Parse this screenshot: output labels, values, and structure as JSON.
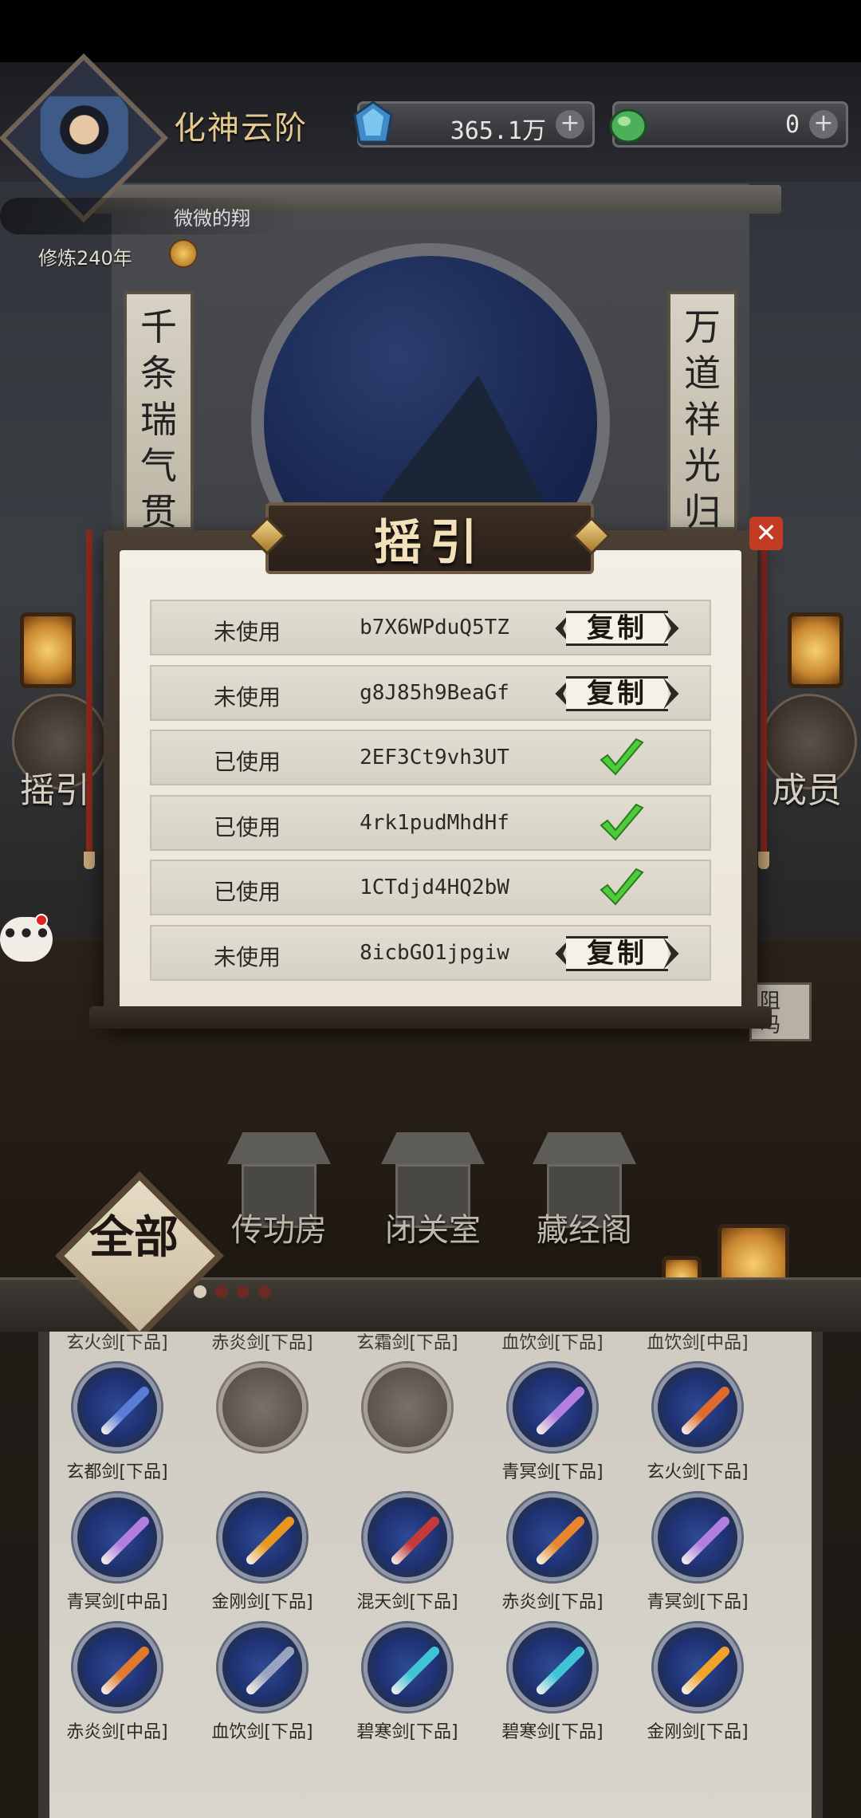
{
  "header": {
    "realm_title": "化神云阶",
    "jade_amount": "365.1万",
    "spirit_amount": "0",
    "plus_symbol": "+",
    "nickname": "微微的翔",
    "cultivation": "修炼240年"
  },
  "scene": {
    "couplet_left": "千条瑞气贯",
    "couplet_right": "万道祥光归",
    "side_left_label": "摇引",
    "side_right_label": "成员",
    "clipped_right_text": "阻\n吗"
  },
  "popup": {
    "title": "摇引",
    "close_symbol": "✕",
    "rows": [
      {
        "status": "未使用",
        "code": "b7X6WPduQ5TZ",
        "action": "复制"
      },
      {
        "status": "未使用",
        "code": "g8J85h9BeaGf",
        "action": "复制"
      },
      {
        "status": "已使用",
        "code": "2EF3Ct9vh3UT",
        "action": ""
      },
      {
        "status": "已使用",
        "code": "4rk1pudMhdHf",
        "action": ""
      },
      {
        "status": "已使用",
        "code": "1CTdjd4HQ2bW",
        "action": ""
      },
      {
        "status": "未使用",
        "code": "8icbGO1jpgiw",
        "action": "复制"
      }
    ]
  },
  "chat": {
    "symbol": "•••"
  },
  "buildings": [
    {
      "label": "传功房"
    },
    {
      "label": "闭关室"
    },
    {
      "label": "藏经阁"
    }
  ],
  "category_badge": "全部",
  "inventory": {
    "cut_labels": [
      "玄火剑[下品]",
      "赤炎剑[下品]",
      "玄霜剑[下品]",
      "血饮剑[下品]",
      "血饮剑[中品]"
    ],
    "rows": [
      [
        {
          "label": "玄都剑[下品]",
          "empty": false,
          "color": "#5a7bd8"
        },
        {
          "label": "",
          "empty": true,
          "color": ""
        },
        {
          "label": "",
          "empty": true,
          "color": ""
        },
        {
          "label": "青冥剑[下品]",
          "empty": false,
          "color": "#b27ee0"
        },
        {
          "label": "玄火剑[下品]",
          "empty": false,
          "color": "#e06a2c"
        }
      ],
      [
        {
          "label": "青冥剑[中品]",
          "empty": false,
          "color": "#b27ee0"
        },
        {
          "label": "金刚剑[下品]",
          "empty": false,
          "color": "#e8961e"
        },
        {
          "label": "混天剑[下品]",
          "empty": false,
          "color": "#c23a3a"
        },
        {
          "label": "赤炎剑[下品]",
          "empty": false,
          "color": "#e7862c"
        },
        {
          "label": "青冥剑[下品]",
          "empty": false,
          "color": "#b27ee0"
        }
      ],
      [
        {
          "label": "赤炎剑[中品]",
          "empty": false,
          "color": "#e07a2c"
        },
        {
          "label": "血饮剑[下品]",
          "empty": false,
          "color": "#9aa4c0"
        },
        {
          "label": "碧寒剑[下品]",
          "empty": false,
          "color": "#3fc4d6"
        },
        {
          "label": "碧寒剑[下品]",
          "empty": false,
          "color": "#3fc4d6"
        },
        {
          "label": "金刚剑[下品]",
          "empty": false,
          "color": "#f0a22a"
        }
      ]
    ]
  },
  "colors": {
    "accent_gold": "#e6c98e",
    "check_green": "#4ecb3a",
    "close_red": "#c33b22"
  }
}
